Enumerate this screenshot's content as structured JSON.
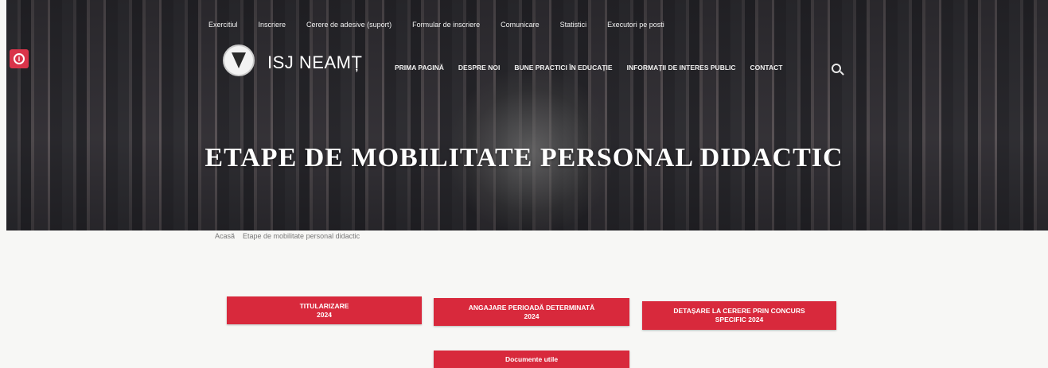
{
  "topnav": [
    "Exercitiul",
    "Inscriere",
    "Cerere de adesive (suport)",
    "Formular de inscriere",
    "Comunicare",
    "Statistici",
    "Executori pe posti"
  ],
  "brand": "ISJ NEAMȚ",
  "mainnav": [
    "PRIMA PAGINĂ",
    "DESPRE NOI",
    "BUNE PRACTICI ÎN EDUCAȚIE",
    "INFORMAȚII DE INTERES PUBLIC",
    "CONTACT"
  ],
  "page_title": "ETAPE DE MOBILITATE PERSONAL DIDACTIC",
  "breadcrumb": {
    "home": "Acasă",
    "current": "Etape de mobilitate personal didactic"
  },
  "buttons": {
    "titularizare": {
      "line1": "TITULARIZARE",
      "line2": "2024"
    },
    "angajare": {
      "line1": "ANGAJARE PERIOADĂ DETERMINATĂ",
      "line2": "2024"
    },
    "detasare": {
      "line1": "DETAȘARE LA CERERE PRIN CONCURS",
      "line2": "SPECIFIC 2024"
    },
    "documente": {
      "line1": "Documente utile"
    }
  },
  "colors": {
    "accent": "#d8293c"
  }
}
